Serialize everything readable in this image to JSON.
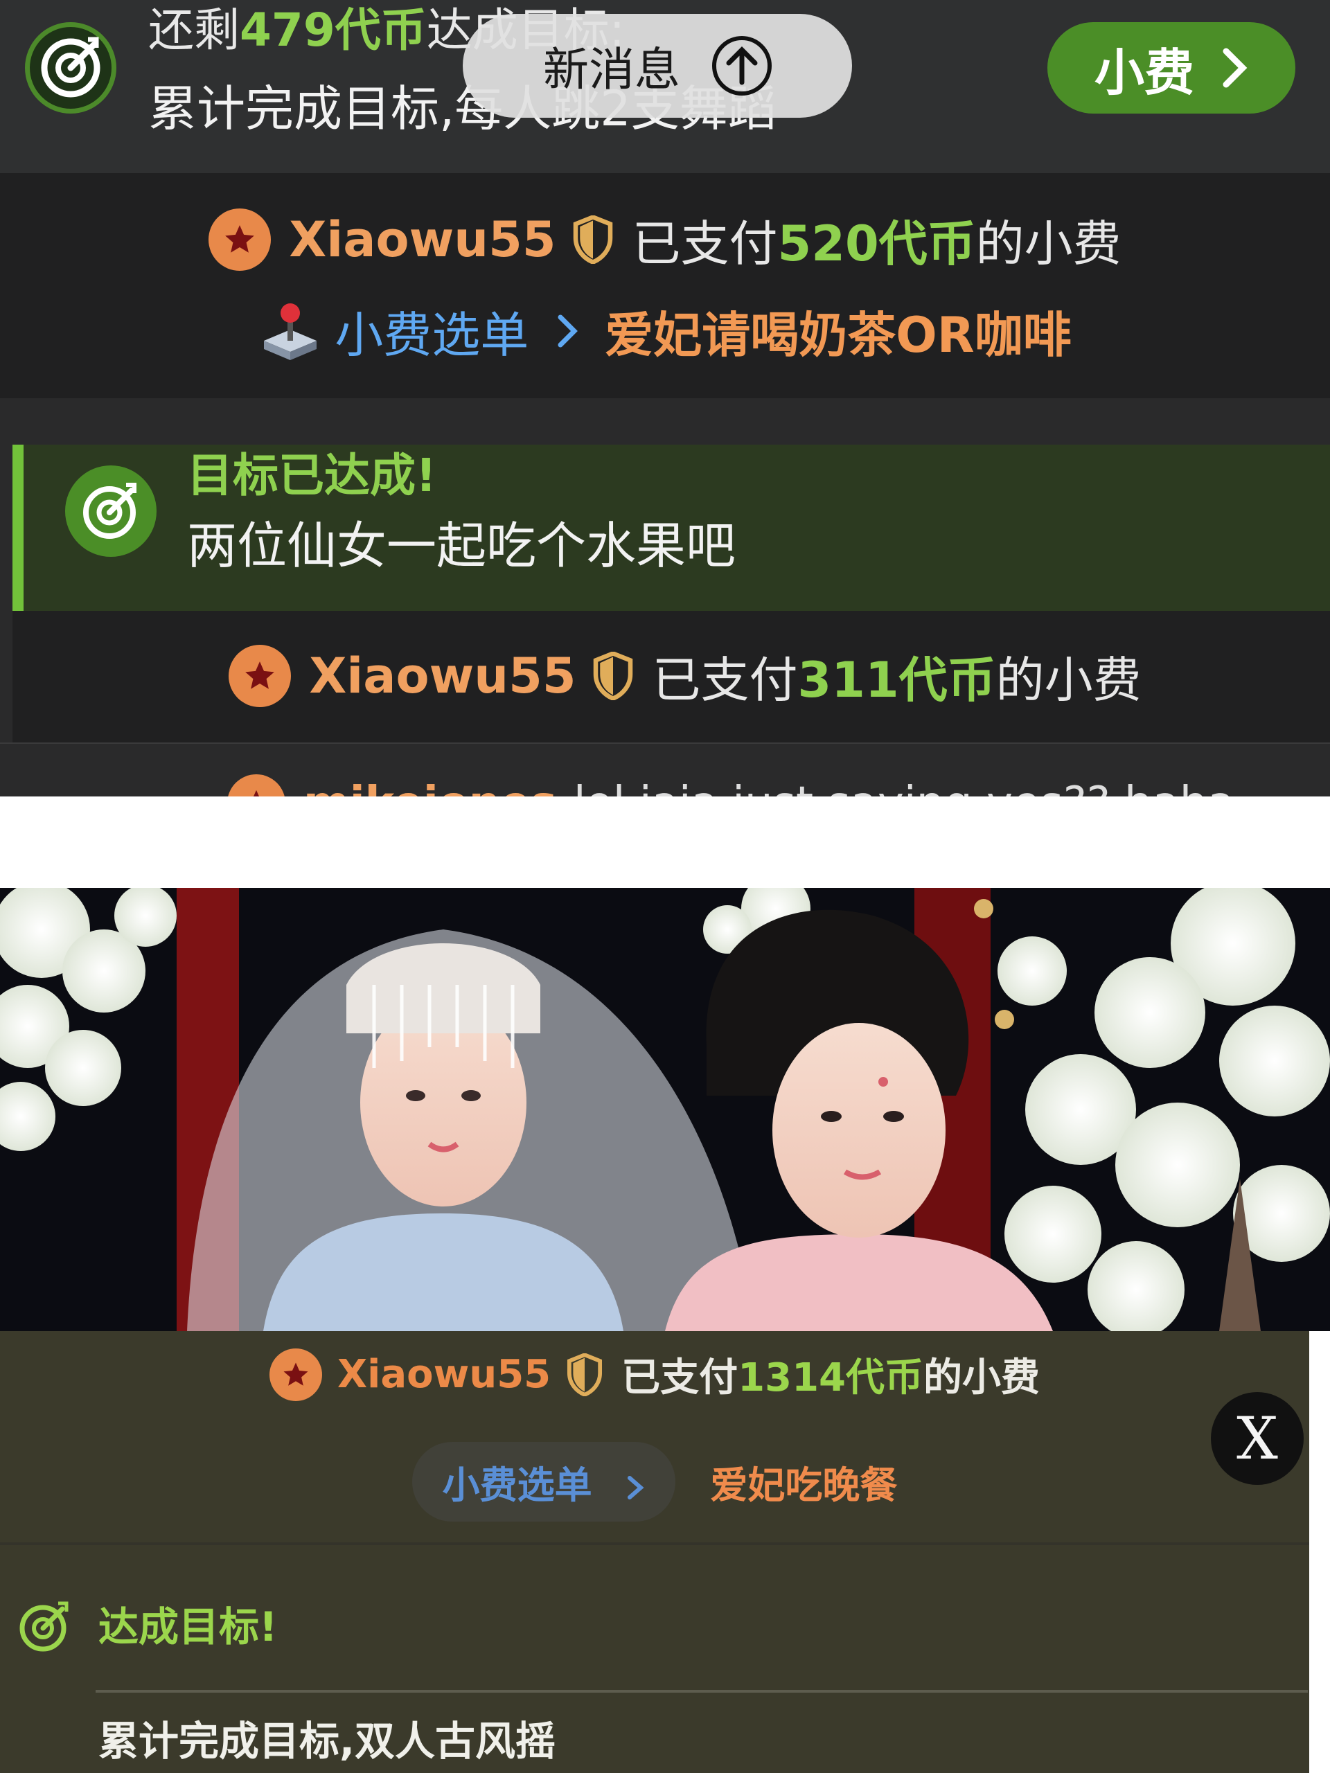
{
  "goal_bar": {
    "remaining_prefix": "还剩",
    "remaining_amount": "479代币",
    "remaining_suffix": "达成目标:",
    "goal_text": "累计完成目标,每人跳2支舞蹈",
    "tip_button_label": "小费"
  },
  "new_messages": {
    "label": "新消息"
  },
  "messages": [
    {
      "user": "Xiaowu55",
      "paid_prefix": "已支付",
      "amount": "520代币",
      "paid_suffix": "的小费",
      "menu_label": "小费选单",
      "menu_item": "爱妃请喝奶茶OR咖啡"
    },
    {
      "user": "Xiaowu55",
      "paid_prefix": "已支付",
      "amount": "311代币",
      "paid_suffix": "的小费"
    }
  ],
  "goal_reached": {
    "title": "目标已达成!",
    "text": "两位仙女一起吃个水果吧"
  },
  "cut_off_message": {
    "user": "mikejones",
    "text": "lol jaja just saying yes?? haha"
  },
  "bottom_overlay": {
    "user": "Xiaowu55",
    "paid_prefix": "已支付",
    "amount": "1314代币",
    "paid_suffix": "的小费",
    "menu_label": "小费选单",
    "menu_item": "爱妃吃晚餐",
    "goal_title": "达成目标!",
    "goal_text": "累计完成目标,双人古风摇",
    "close_label": "X"
  },
  "colors": {
    "accent_green": "#8fd14f",
    "username_orange": "#f0a060",
    "menu_blue": "#5fa8f2",
    "menu_item_orange": "#f29954",
    "tip_button": "#4b8e27"
  }
}
